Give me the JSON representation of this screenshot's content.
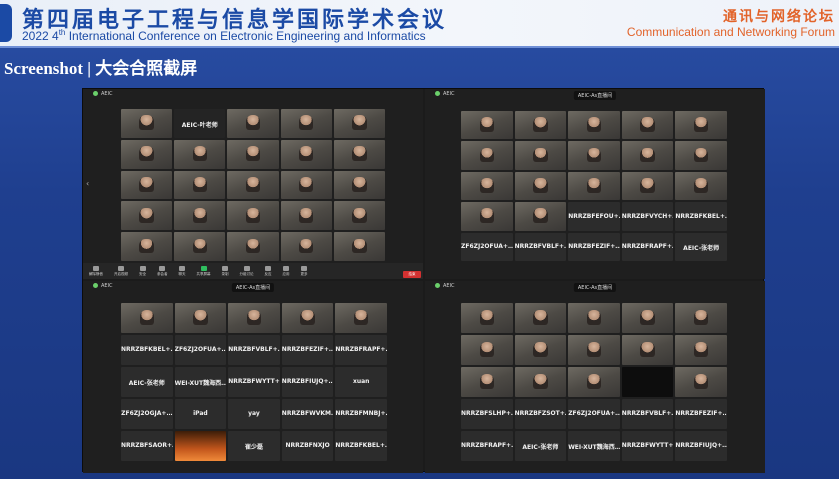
{
  "header": {
    "title_cn": "第四届电子工程与信息学国际学术会议",
    "subtitle_year": "2022 4",
    "subtitle_sup": "th",
    "subtitle_rest": " International Conference on Electronic Engineering and Informatics",
    "right_cn": "通讯与网络论坛",
    "right_en": "Communication and Networking Forum"
  },
  "section_title": "Screenshot | 大会合照截屏",
  "meeting": {
    "room_title": "AEIC-As直播间",
    "record_label": "录制",
    "end_label": "结束",
    "toolbar": [
      "解除静音",
      "开启视频",
      "安全",
      "参会者",
      "聊天",
      "共享屏幕",
      "录制",
      "分组讨论",
      "反应",
      "应用",
      "更多"
    ]
  },
  "quads": {
    "top_left": {
      "host_name": "AEIC-叶老师"
    },
    "top_right": {
      "names": [
        "NRRZBFEFOU+…",
        "NRRZBFVYCH+…",
        "NRRZBFKBEL+…",
        "ZF6ZJ2OFUA+…",
        "NRRZBFVBLF+…",
        "NRRZBFEZIF+…",
        "NRRZBFRAPF+…",
        "AEIC-张老师"
      ]
    },
    "bottom_left": {
      "names": [
        "NRRZBFKBEL+…",
        "ZF6ZJ2OFUA+…",
        "NRRZBFVBLF+…",
        "NRRZBFEZIF+…",
        "NRRZBFRAPF+…",
        "AEIC-张老师",
        "WEI-XUT魏海西…",
        "NRRZBFWYTT+…",
        "NRRZBFIUJQ+…",
        "xuan",
        "ZF6ZJ2OGJA+…",
        "iPad",
        "yay",
        "NRRZBFWVKM…",
        "NRRZBFMNBJ+…",
        "NRRZBFSAOR+…",
        "",
        "崔少磊",
        "NRRZBFNXJO",
        "NRRZBFKBEL+…"
      ]
    },
    "bottom_right": {
      "names": [
        "NRRZBFSLHP+…",
        "NRRZBFZSOT+…",
        "ZF6ZJ2OFUA+…",
        "NRRZBFVBLF+…",
        "NRRZBFEZIF+…",
        "NRRZBFRAPF+…",
        "AEIC-张老师",
        "WEI-XUT魏海西…",
        "NRRZBFWYTT+…",
        "NRRZBFIUJQ+…"
      ]
    }
  },
  "colors": {
    "banner_blue": "#1b4aa5",
    "banner_orange": "#e2632a",
    "page_bg": "#2a4fa6",
    "end_red": "#e23b3b"
  }
}
